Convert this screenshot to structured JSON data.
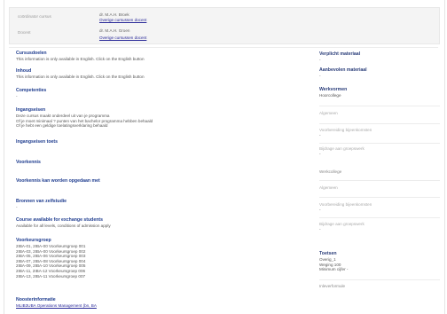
{
  "header": {
    "rows": [
      {
        "label": "coördinator cursus",
        "value": "dr. M.A.H. Broek",
        "link": "Overige cursussen docent"
      },
      {
        "label": "Docent",
        "value": "dr. M.A.H. Groen",
        "link": "Overige cursussen docent"
      }
    ]
  },
  "main": {
    "cursusdoelen": {
      "title": "Cursusdoelen",
      "text": "This information is only available in English. Click on the English button"
    },
    "inhoud": {
      "title": "Inhoud",
      "text": "This information is only available in English. Click on the English button"
    },
    "competenties": {
      "title": "Competenties",
      "text": "-"
    },
    "ingangseisen": {
      "title": "Ingangseisen",
      "lines": [
        "Deze cursus maakt onderdeel uit van je programma",
        "Of je moet minimaal ? punten van het bachelor programma hebben behaald",
        "Of je hebt een geldige toelatingsverklaring behaald"
      ]
    },
    "ingangseisen_toets": {
      "title": "Ingangseisen toets"
    },
    "voorkennis": {
      "title": "Voorkennis"
    },
    "voorkennis_opgedaan": {
      "title": "Voorkennis kan worden opgedaan met"
    },
    "bronnen": {
      "title": "Bronnen van zelfstudie",
      "text": "-"
    },
    "exchange": {
      "title": "Course available for exchange students",
      "text": "Available for all levels, conditions of admission apply"
    },
    "voorkeursgroep": {
      "title": "Voorkeursgroep",
      "lines": [
        "2IBA-01, 2IBA-00 Voorkeursgroep 001",
        "2IBA-03, 2IBA-00 Voorkeursgroep 002",
        "2IBA-05, 2IBA-06 Voorkeursgroep 003",
        "2IBA-07, 2IBA-08 Voorkeursgroep 004",
        "2IBA-09, 2IBA-10 Voorkeursgroep 005",
        "2IBA-11, 2IBA-12 Voorkeursgroep 006",
        "2IBA-13, 2IBA-11 Voorkeursgroep 007"
      ]
    },
    "nooster": {
      "title": "Noosterinformatie",
      "link": "MLIB3UBA Operations Management (bn, BA"
    }
  },
  "side": {
    "verplicht": {
      "title": "Verplicht materiaal",
      "text": "-"
    },
    "aanbevolen": {
      "title": "Aanbevolen materiaal",
      "text": "-"
    },
    "werkvormen": {
      "title": "Werkvormen",
      "subtitle": "Hoorcollege"
    },
    "hc": [
      {
        "label": "Algemeen",
        "value": ""
      },
      {
        "label": "Voorbereiding bijeenkomsten",
        "value": "-"
      },
      {
        "label": "Bijdrage aan groepswerk",
        "value": "-"
      }
    ],
    "werkcollege": {
      "title": "Werkcollege"
    },
    "wc": [
      {
        "label": "Algemeen",
        "value": ""
      },
      {
        "label": "Voorbereiding bijeenkomsten",
        "value": "-"
      },
      {
        "label": "Bijdrage aan groepswerk",
        "value": "-"
      }
    ],
    "toetsen": {
      "title": "Toetsen",
      "lines": [
        "Overig_1",
        "Weging 100",
        "Minimum cijfer -"
      ],
      "label": "Inleverformule"
    }
  }
}
